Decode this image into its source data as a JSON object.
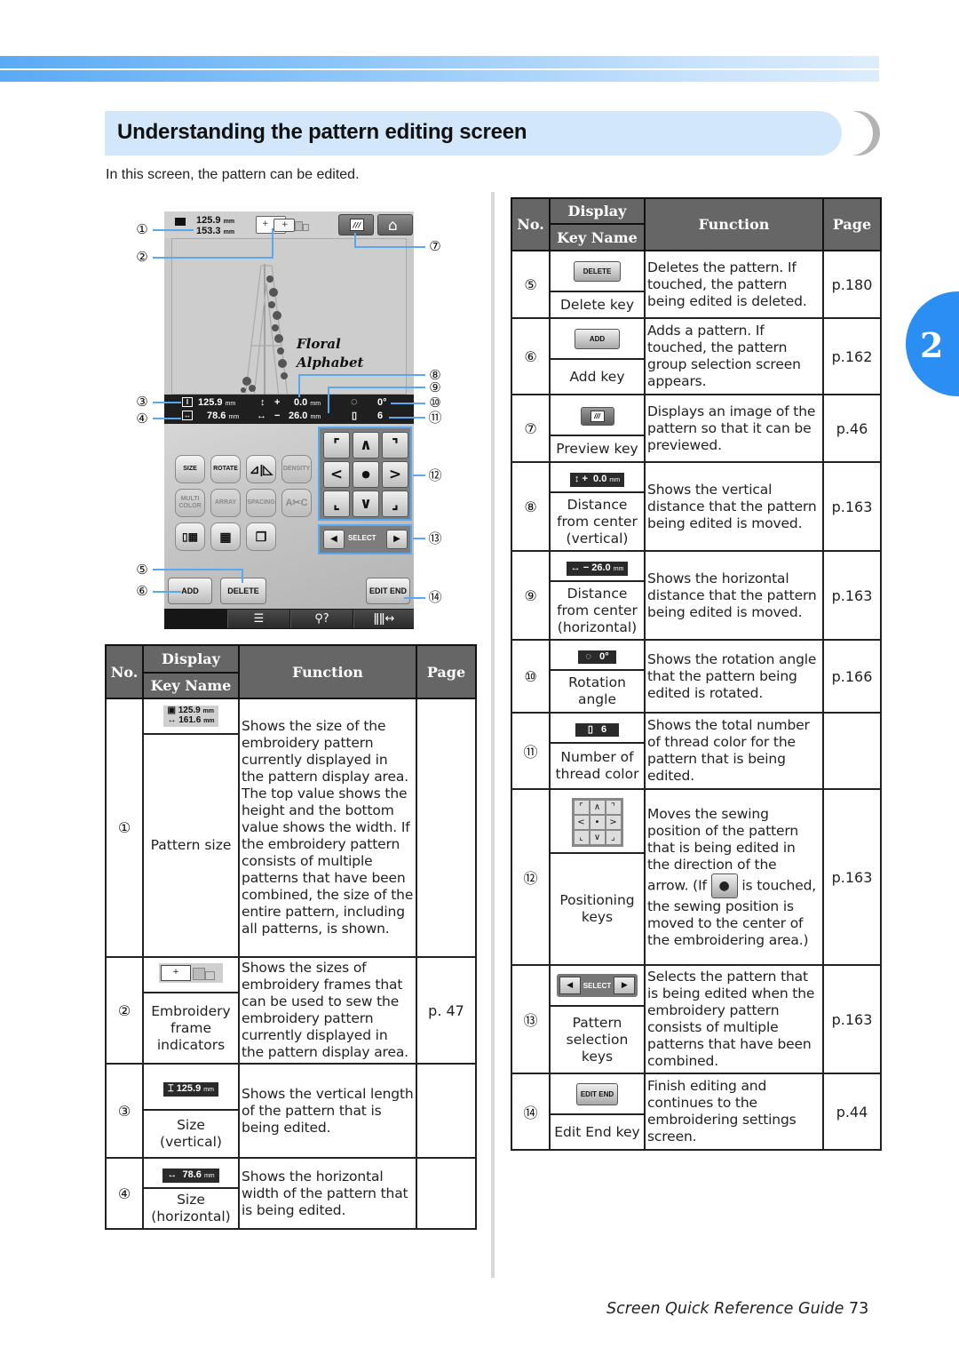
{
  "section": {
    "title": "Understanding the pattern editing screen",
    "intro": "In this screen, the pattern can be edited.",
    "chapter_number": "2"
  },
  "screen": {
    "pattern_height": "125.9",
    "pattern_width": "153.3",
    "unit": "mm",
    "preview_key_icon": "preview-icon",
    "home_key_icon": "home-icon",
    "pattern_caption_line1": "Floral",
    "pattern_caption_line2": "Alphabet",
    "status": {
      "size_vertical": "125.9",
      "size_horizontal": "78.6",
      "distance_vertical_sign": "+",
      "distance_vertical": "0.0",
      "distance_horizontal_sign": "−",
      "distance_horizontal": "26.0",
      "rotation": "0°",
      "thread_colors": "6"
    },
    "function_keys": [
      {
        "label": "SIZE",
        "enabled": true
      },
      {
        "label": "ROTATE",
        "enabled": true
      },
      {
        "label": "",
        "icon": "mirror-icon",
        "enabled": true
      },
      {
        "label": "DENSITY",
        "enabled": false
      },
      {
        "label": "MULTI COLOR",
        "enabled": false
      },
      {
        "label": "ARRAY",
        "enabled": false
      },
      {
        "label": "SPACING",
        "enabled": false
      },
      {
        "label": "",
        "icon": "letter-cut-icon",
        "enabled": false
      },
      {
        "label": "",
        "icon": "border-icon",
        "enabled": true
      },
      {
        "label": "",
        "icon": "grid-icon",
        "enabled": true
      },
      {
        "label": "",
        "icon": "duplicate-icon",
        "enabled": true
      }
    ],
    "positioning_keys": [
      "⌜",
      "∧",
      "⌝",
      "<",
      "●",
      ">",
      "⌞",
      "∨",
      "⌟"
    ],
    "select_label": "SELECT",
    "add_label": "ADD",
    "delete_label": "DELETE",
    "edit_end_label": "EDIT END",
    "bottom_bar": [
      "list-icon",
      "help-icon",
      "thread-icon"
    ]
  },
  "callouts": [
    "①",
    "②",
    "③",
    "④",
    "⑤",
    "⑥",
    "⑦",
    "⑧",
    "⑨",
    "⑩",
    "⑪",
    "⑫",
    "⑬",
    "⑭"
  ],
  "table_headers": {
    "no": "No.",
    "display": "Display",
    "key_name": "Key Name",
    "function": "Function",
    "page": "Page"
  },
  "rows_left": [
    {
      "no": "①",
      "display": {
        "top": "125.9",
        "bottom": "161.6",
        "unit": "mm"
      },
      "key_name": "Pattern size",
      "function": "Shows the size of the embroidery pattern currently displayed in the pattern display area. The top value shows the height and the bottom value shows the width. If the embroidery pattern consists of multiple patterns that have been combined, the size of the entire pattern, including all patterns, is shown.",
      "page": ""
    },
    {
      "no": "②",
      "display": {
        "icon": "frame-indicator-icon"
      },
      "key_name": "Embroidery frame indicators",
      "function": "Shows the sizes of embroidery frames that can be used to sew the embroidery pattern currently displayed in the pattern display area.",
      "page": "p. 47"
    },
    {
      "no": "③",
      "display": {
        "value": "125.9",
        "unit": "mm"
      },
      "key_name": "Size (vertical)",
      "function": "Shows the vertical length of the pattern that is being edited.",
      "page": ""
    },
    {
      "no": "④",
      "display": {
        "value": "78.6",
        "unit": "mm"
      },
      "key_name": "Size (horizontal)",
      "function": "Shows the horizontal width of the pattern that is being edited.",
      "page": ""
    }
  ],
  "rows_right": [
    {
      "no": "⑤",
      "display": {
        "label": "DELETE"
      },
      "key_name": "Delete key",
      "function": "Deletes the pattern. If touched, the pattern being edited is deleted.",
      "page": "p.180"
    },
    {
      "no": "⑥",
      "display": {
        "label": "ADD"
      },
      "key_name": "Add key",
      "function": "Adds a pattern. If touched, the pattern group selection screen appears.",
      "page": "p.162"
    },
    {
      "no": "⑦",
      "display": {
        "icon": "preview-icon"
      },
      "key_name": "Preview key",
      "function": "Displays an image of the pattern so that it can be previewed.",
      "page": "p.46"
    },
    {
      "no": "⑧",
      "display": {
        "sign": "+",
        "value": "0.0",
        "unit": "mm"
      },
      "key_name": "Distance from center (vertical)",
      "function": "Shows the vertical distance that the pattern being edited is moved.",
      "page": "p.163"
    },
    {
      "no": "⑨",
      "display": {
        "sign": "−",
        "value": "26.0",
        "unit": "mm"
      },
      "key_name": "Distance from center (horizontal)",
      "function": "Shows the horizontal distance that the pattern being edited is moved.",
      "page": "p.163"
    },
    {
      "no": "⑩",
      "display": {
        "value": "0°"
      },
      "key_name": "Rotation angle",
      "function": "Shows the rotation angle that the pattern being edited is rotated.",
      "page": "p.166"
    },
    {
      "no": "⑪",
      "display": {
        "value": "6"
      },
      "key_name": "Number of thread color",
      "function": "Shows the total number of thread color for the pattern that is being edited.",
      "page": ""
    },
    {
      "no": "⑫",
      "display": {
        "icon": "positioning-keys-icon"
      },
      "key_name": "Positioning keys",
      "function_before": "Moves the sewing position of the pattern that is being edited in the direction of the arrow. (If",
      "function_after": "is touched, the sewing position is moved to the center of the embroidering area.)",
      "page": "p.163"
    },
    {
      "no": "⑬",
      "display": {
        "label": "SELECT"
      },
      "key_name": "Pattern selection keys",
      "function": "Selects the pattern that is being edited when the embroidery pattern consists of multiple patterns that have been combined.",
      "page": "p.163"
    },
    {
      "no": "⑭",
      "display": {
        "label": "EDIT END"
      },
      "key_name": "Edit End key",
      "function": "Finish editing and continues to the embroidering settings screen.",
      "page": "p.44"
    }
  ],
  "footer": {
    "text": "Screen Quick Reference Guide",
    "page_number": "73"
  },
  "colors": {
    "accent_blue": "#2b8ef3",
    "heading_bg": "#d3e7fb",
    "table_header_bg": "#666666",
    "callout_line": "#5aa8f0"
  }
}
